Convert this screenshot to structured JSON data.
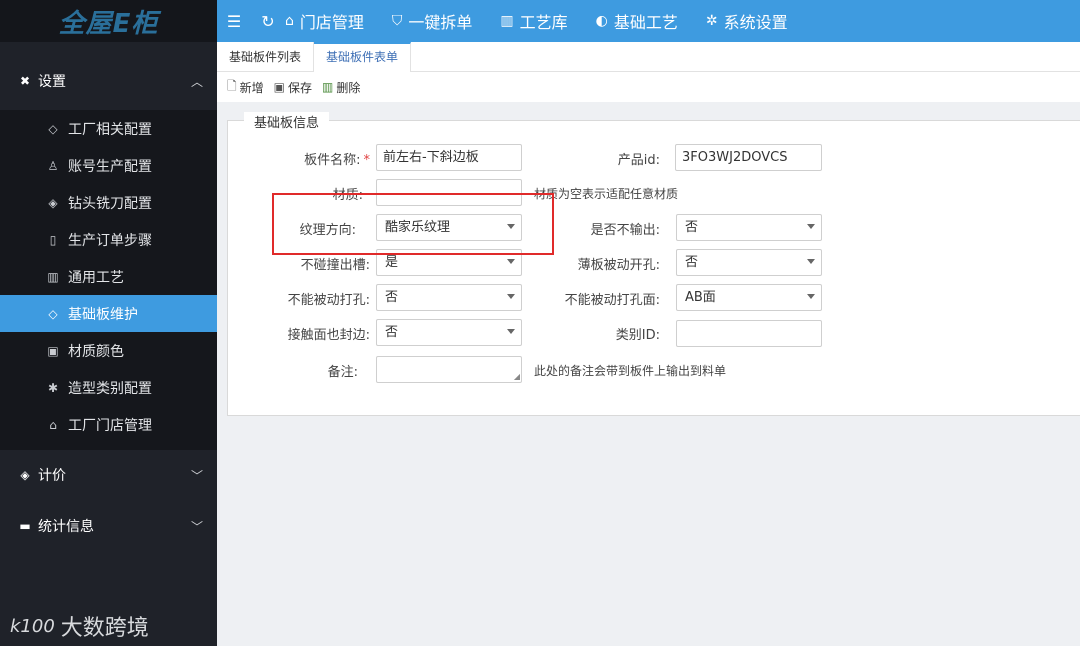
{
  "app": {
    "logo": "全屋E柜"
  },
  "topnav": {
    "items": [
      {
        "label": "门店管理",
        "icon": "home-icon"
      },
      {
        "label": "一键拆单",
        "icon": "shield-icon"
      },
      {
        "label": "工艺库",
        "icon": "library-icon"
      },
      {
        "label": "基础工艺",
        "icon": "palette-icon"
      },
      {
        "label": "系统设置",
        "icon": "gear-icon"
      }
    ]
  },
  "sidebar": {
    "settings_label": "设置",
    "items": [
      {
        "label": "工厂相关配置",
        "icon": "tag-icon"
      },
      {
        "label": "账号生产配置",
        "icon": "user-icon"
      },
      {
        "label": "钻头铣刀配置",
        "icon": "diamond-icon"
      },
      {
        "label": "生产订单步骤",
        "icon": "steps-icon"
      },
      {
        "label": "通用工艺",
        "icon": "bank-icon"
      },
      {
        "label": "基础板维护",
        "icon": "tag-icon"
      },
      {
        "label": "材质颜色",
        "icon": "image-icon"
      },
      {
        "label": "造型类别配置",
        "icon": "palm-icon"
      },
      {
        "label": "工厂门店管理",
        "icon": "home-icon"
      }
    ],
    "pricing_label": "计价",
    "stats_label": "统计信息",
    "watermark": "大数跨境",
    "watermark_logo": "k100"
  },
  "tabs": [
    {
      "label": "基础板件列表"
    },
    {
      "label": "基础板件表单"
    }
  ],
  "toolbar": {
    "new": "新增",
    "save": "保存",
    "delete": "删除"
  },
  "form": {
    "legend": "基础板信息",
    "board_name_label": "板件名称:",
    "board_name_value": "前左右-下斜边板",
    "product_id_label": "产品id:",
    "product_id_value": "3FO3WJ2DOVCS",
    "material_label": "材质:",
    "material_value": "",
    "material_hint": "材质为空表示适配任意材质",
    "texture_label": "纹理方向:",
    "texture_value": "酷家乐纹理",
    "no_output_label": "是否不输出:",
    "no_output_value": "否",
    "no_slot_label": "不碰撞出槽:",
    "no_slot_value": "是",
    "thin_hole_label": "薄板被动开孔:",
    "thin_hole_value": "否",
    "no_passive_hole_label": "不能被动打孔:",
    "no_passive_hole_value": "否",
    "no_passive_face_label": "不能被动打孔面:",
    "no_passive_face_value": "AB面",
    "contact_edge_label": "接触面也封边:",
    "contact_edge_value": "否",
    "category_id_label": "类别ID:",
    "category_id_value": "",
    "remark_label": "备注:",
    "remark_hint": "此处的备注会带到板件上输出到料单"
  },
  "colors": {
    "accent": "#3e9be0",
    "sidebar_bg": "#1f2229",
    "highlight": "#e02a2a"
  }
}
